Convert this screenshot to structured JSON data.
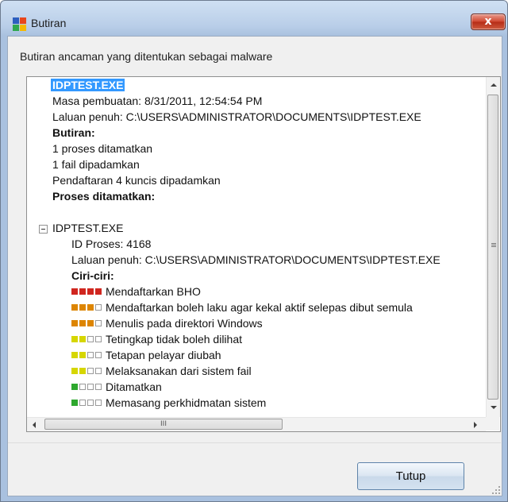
{
  "window": {
    "title": "Butiran",
    "close_label": "x"
  },
  "heading": "Butiran ancaman yang ditentukan sebagai malware",
  "tree": {
    "selected_item": "IDPTEST.EXE",
    "created": "Masa pembuatan: 8/31/2011, 12:54:54 PM",
    "path": "Laluan penuh: C:\\USERS\\ADMINISTRATOR\\DOCUMENTS\\IDPTEST.EXE",
    "details_header": "Butiran:",
    "details": [
      "1 proses ditamatkan",
      "1 fail dipadamkan",
      "Pendaftaran 4 kuncis dipadamkan"
    ],
    "processes_header": "Proses ditamatkan:",
    "process": {
      "name": "IDPTEST.EXE",
      "pid": "ID Proses: 4168",
      "path": "Laluan penuh: C:\\USERS\\ADMINISTRATOR\\DOCUMENTS\\IDPTEST.EXE",
      "traits_header": "Ciri-ciri:"
    },
    "traits": [
      {
        "label": "Mendaftarkan BHO",
        "level": 4,
        "color": "#d0261f"
      },
      {
        "label": "Mendaftarkan boleh laku agar kekal aktif selepas dibut semula",
        "level": 3,
        "color": "#dd8500"
      },
      {
        "label": "Menulis pada direktori Windows",
        "level": 3,
        "color": "#dd8500"
      },
      {
        "label": "Tetingkap tidak boleh dilihat",
        "level": 2,
        "color": "#d6d600"
      },
      {
        "label": "Tetapan pelayar diubah",
        "level": 2,
        "color": "#d6d600"
      },
      {
        "label": "Melaksanakan dari sistem fail",
        "level": 2,
        "color": "#d6d600"
      },
      {
        "label": "Ditamatkan",
        "level": 1,
        "color": "#2ea82e"
      },
      {
        "label": "Memasang perkhidmatan sistem",
        "level": 1,
        "color": "#2ea82e"
      }
    ],
    "hscroll_grip": "III"
  },
  "buttons": {
    "close_label": "Tutup"
  }
}
